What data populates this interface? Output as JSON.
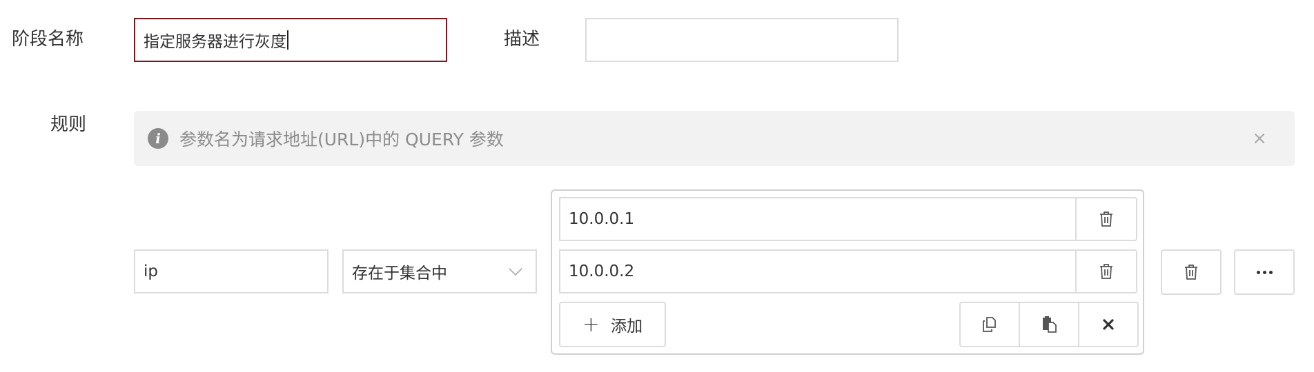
{
  "form": {
    "stage_name_label": "阶段名称",
    "stage_name_value": "指定服务器进行灰度",
    "description_label": "描述",
    "description_value": "",
    "rules_label": "规则"
  },
  "alert": {
    "icon": "info-icon",
    "text": "参数名为请求地址(URL)中的 QUERY 参数",
    "close_glyph": "×"
  },
  "rule": {
    "param_value": "ip",
    "operator_value": "存在于集合中",
    "set_values": [
      "10.0.0.1",
      "10.0.0.2"
    ],
    "add_label": "添加",
    "add_glyph": "+"
  },
  "icons": {
    "delete": "trash-icon",
    "copy": "copy-icon",
    "paste": "paste-icon",
    "clear": "close-icon",
    "more": "more-icon",
    "chevron": "chevron-down-icon"
  },
  "colors": {
    "focus_border": "#7a1820",
    "alert_bg": "#f2f2f2",
    "border": "#dcdcdc"
  }
}
